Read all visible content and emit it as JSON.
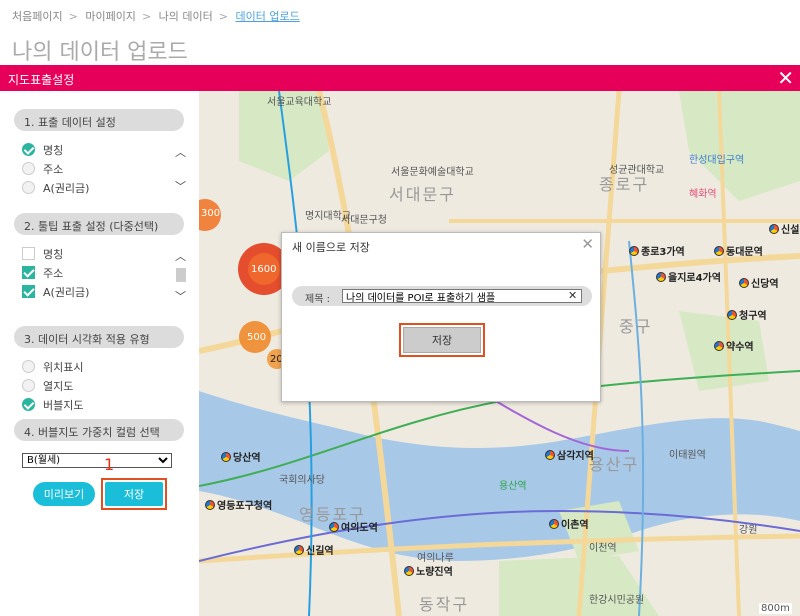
{
  "breadcrumb": [
    "처음페이지",
    "마이페이지",
    "나의 데이터",
    "데이터 업로드"
  ],
  "page_title": "나의 데이터 업로드",
  "modal": {
    "title": "지도표출설정",
    "close": "✕"
  },
  "sidebar": {
    "sec1": {
      "title": "1. 표출 데이터 설정",
      "options": [
        {
          "label": "명칭",
          "checked": true
        },
        {
          "label": "주소",
          "checked": false
        },
        {
          "label": "A(권리금)",
          "checked": false
        }
      ]
    },
    "sec2": {
      "title": "2. 툴팁 표출 설정 (다중선택)",
      "options": [
        {
          "label": "명칭",
          "checked": false
        },
        {
          "label": "주소",
          "checked": true
        },
        {
          "label": "A(권리금)",
          "checked": true
        }
      ]
    },
    "sec3": {
      "title": "3. 데이터 시각화 적용 유형",
      "options": [
        {
          "label": "위치표시",
          "checked": false
        },
        {
          "label": "열지도",
          "checked": false
        },
        {
          "label": "버블지도",
          "checked": true
        }
      ]
    },
    "sec4": {
      "title": "4. 버블지도 가중치 컬럼 선택",
      "selected": "B(월세)"
    },
    "preview_label": "미리보기",
    "save_label": "저장",
    "step_marker": "1"
  },
  "map": {
    "districts": [
      "서대문구",
      "종로구",
      "중구",
      "용산구",
      "동작구",
      "영등포구"
    ],
    "stations": [
      "종로3가역",
      "동대문역",
      "을지로4가역",
      "신당역",
      "청구역",
      "약수역",
      "삼각지역",
      "이촌역",
      "당산역",
      "영등포구청역",
      "여의도역",
      "신길역",
      "노량진역",
      "신설"
    ],
    "places": [
      "서울교육대학교",
      "서울문화예술대학교",
      "명지대학교",
      "서대문구청",
      "성균관대학교",
      "혜화역",
      "한성대입구역",
      "이태원역",
      "국회의사당",
      "용산역",
      "강원",
      "한강시민공원",
      "여의나루",
      "이천역"
    ],
    "bubbles": [
      {
        "label": "300"
      },
      {
        "label": "1600"
      },
      {
        "label": "500"
      },
      {
        "label": "20"
      }
    ],
    "scale": "800m"
  },
  "dialog": {
    "title": "새 이름으로 저장",
    "close": "✕",
    "field_label": "제목 :",
    "field_value": "나의 데이터를 POI로 표출하기 샘플",
    "clear": "✕",
    "save_label": "저장"
  },
  "colors": {
    "accent": "#e6005a",
    "button": "#1bbed8",
    "check": "#2bb5a0",
    "highlight": "#e05020"
  }
}
